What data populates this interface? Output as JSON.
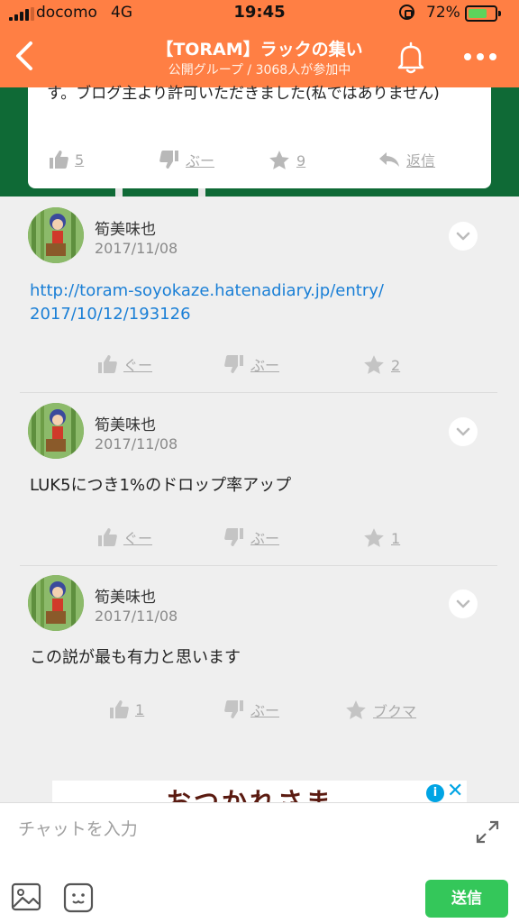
{
  "status_bar": {
    "carrier": "docomo",
    "network": "4G",
    "time": "19:45",
    "battery_percent": "72%",
    "battery_level": 0.72
  },
  "header": {
    "title": "【TORAM】ラックの集い",
    "subtitle": "公開グループ / 3068人が参加中",
    "back_icon": "chevron-left-icon",
    "bell_icon": "bell-icon",
    "more_icon": "more-dots-icon"
  },
  "top_card": {
    "text": "す。ブログ主より許可いただきました(私ではありません)",
    "actions": {
      "good_count": "5",
      "boo_label": "ぶー",
      "star_count": "9",
      "reply_label": "返信"
    }
  },
  "comments": [
    {
      "author": "筍美味也",
      "date": "2017/11/08",
      "body_line1": "http://toram-soyokaze.hatenadiary.jp/entry/",
      "body_line2": "2017/10/12/193126",
      "good_label": "ぐー",
      "boo_label": "ぶー",
      "star_label": "2"
    },
    {
      "author": "筍美味也",
      "date": "2017/11/08",
      "body": "LUK5につき1%のドロップ率アップ",
      "good_label": "ぐー",
      "boo_label": "ぶー",
      "star_label": "1"
    },
    {
      "author": "筍美味也",
      "date": "2017/11/08",
      "body": "この説が最も有力と思います",
      "good_label": "1",
      "boo_label": "ぶー",
      "star_label": "ブクマ"
    }
  ],
  "ad": {
    "text": "おつかれさま",
    "info_label": "i",
    "close_label": "✕"
  },
  "chat": {
    "placeholder": "チャットを入力",
    "send_label": "送信"
  },
  "colors": {
    "header": "#ff7f44",
    "banner": "#0f6a36",
    "link": "#1a7fd6",
    "send": "#34c75a"
  }
}
